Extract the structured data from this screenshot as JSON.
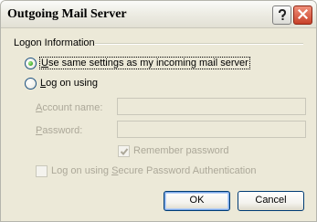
{
  "window": {
    "title": "Outgoing Mail Server",
    "help_icon": "question-mark",
    "close_icon": "x"
  },
  "logon": {
    "group_label": "Logon Information",
    "option_same": {
      "before": "",
      "mnemonic": "U",
      "after": "se same settings as my incoming mail server",
      "selected": true
    },
    "option_logon": {
      "before": "",
      "mnemonic": "L",
      "after": "og on using",
      "selected": false
    },
    "account_name": {
      "before": "",
      "mnemonic": "A",
      "after": "ccount name:",
      "value": ""
    },
    "password": {
      "before": "",
      "mnemonic": "P",
      "after": "assword:",
      "value": ""
    },
    "remember_password": {
      "label": "Remember password",
      "checked": true
    },
    "spa": {
      "before": "Log on using ",
      "mnemonic": "S",
      "after": "ecure Password Authentication",
      "checked": false
    }
  },
  "buttons": {
    "ok": "OK",
    "cancel": "Cancel"
  },
  "colors": {
    "dialog_bg": "#ece9d8",
    "disabled_text": "#aca899",
    "close_red": "#c8412a",
    "radio_green": "#3fa82a"
  }
}
